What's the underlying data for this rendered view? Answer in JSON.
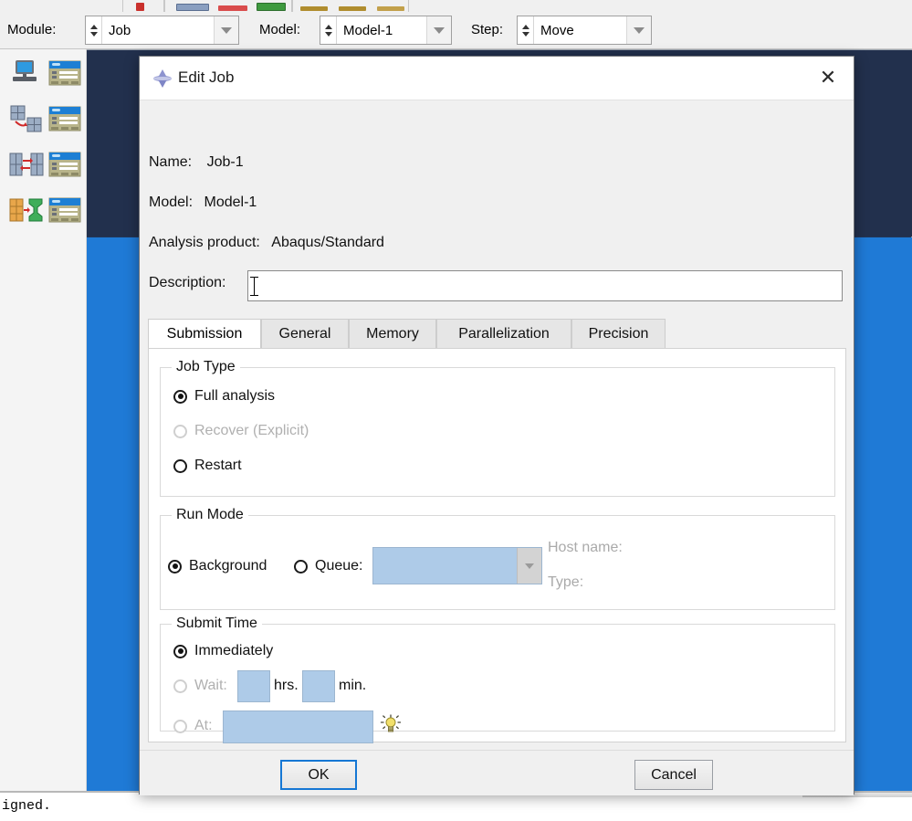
{
  "app": {
    "context_bar": {
      "module": {
        "label": "Module:",
        "value": "Job"
      },
      "model": {
        "label": "Model:",
        "value": "Model-1"
      },
      "step": {
        "label": "Step:",
        "value": "Move"
      }
    },
    "toolbox": {
      "icons": [
        {
          "name": "job-manager-icon"
        },
        {
          "name": "job-create-icon"
        },
        {
          "name": "adaptivity-manager-icon"
        },
        {
          "name": "adaptivity-create-icon"
        },
        {
          "name": "co-execution-manager-icon"
        },
        {
          "name": "co-execution-create-icon"
        },
        {
          "name": "optimization-manager-icon"
        },
        {
          "name": "optimization-create-icon"
        }
      ]
    },
    "message_area": {
      "text": "igned."
    }
  },
  "dialog": {
    "title": "Edit Job",
    "title_icon": "abaqus-job-icon",
    "close_icon": "close-icon",
    "fields": [
      {
        "label": "Name:",
        "value": "Job-1"
      },
      {
        "label": "Model:",
        "value": "Model-1"
      },
      {
        "label": "Analysis product:",
        "value": "Abaqus/Standard"
      }
    ],
    "description": {
      "label": "Description:",
      "value": "",
      "placeholder": ""
    },
    "tabs": [
      {
        "label": "Submission",
        "active": true
      },
      {
        "label": "General",
        "active": false
      },
      {
        "label": "Memory",
        "active": false
      },
      {
        "label": "Parallelization",
        "active": false
      },
      {
        "label": "Precision",
        "active": false
      }
    ],
    "job_type": {
      "title": "Job Type",
      "options": [
        {
          "label": "Full analysis",
          "checked": true,
          "enabled": true
        },
        {
          "label": "Recover (Explicit)",
          "checked": false,
          "enabled": false
        },
        {
          "label": "Restart",
          "checked": false,
          "enabled": true
        }
      ]
    },
    "run_mode": {
      "title": "Run Mode",
      "options": [
        {
          "label": "Background",
          "checked": true,
          "enabled": true
        },
        {
          "label": "Queue:",
          "checked": false,
          "enabled": true
        }
      ],
      "queue_value": "",
      "host_name_label": "Host name:",
      "type_label": "Type:"
    },
    "submit_time": {
      "title": "Submit Time",
      "immediately": {
        "label": "Immediately",
        "checked": true,
        "enabled": true
      },
      "wait": {
        "label": "Wait:",
        "checked": false,
        "enabled": false,
        "hrs_value": "",
        "hrs_label": "hrs.",
        "min_value": "",
        "min_label": "min."
      },
      "at": {
        "label": "At:",
        "checked": false,
        "enabled": false,
        "value": "",
        "hint_icon": "lightbulb-icon"
      }
    },
    "buttons": {
      "ok": "OK",
      "cancel": "Cancel"
    }
  },
  "colors": {
    "accent_blue": "#1577d4",
    "disabled_field": "#aecbe8",
    "viewport_dark": "#22304d",
    "viewport_blue": "#1f7ad6",
    "dialog_bg": "#f0f0f0"
  }
}
